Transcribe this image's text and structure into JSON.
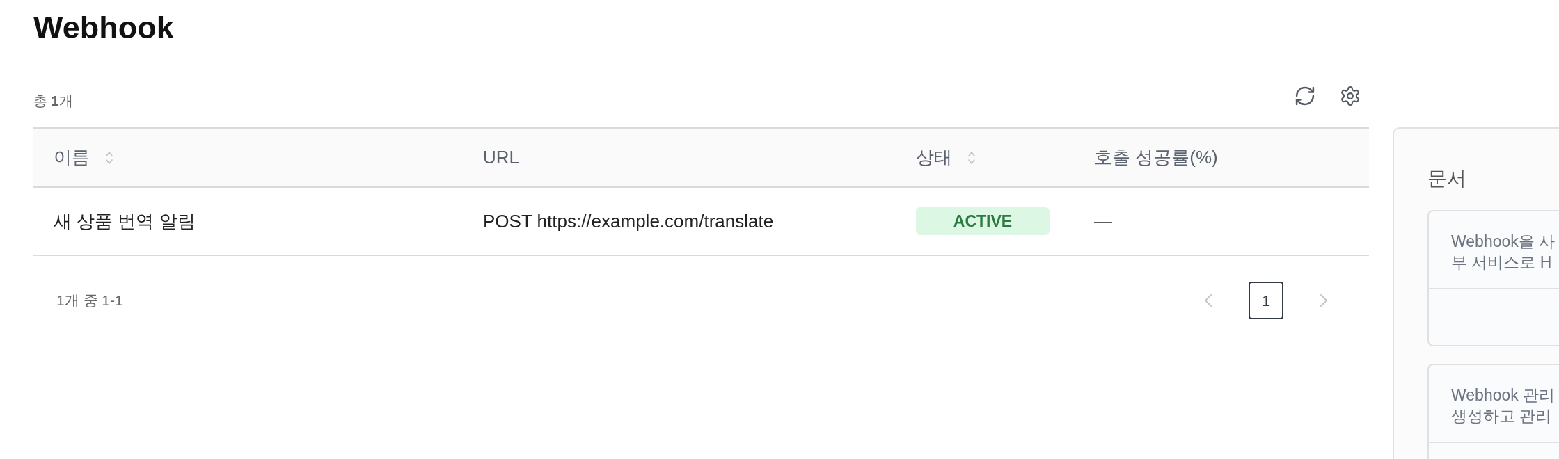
{
  "page": {
    "title": "Webhook"
  },
  "toolbar": {
    "count": "총 **1**개"
  },
  "table": {
    "columns": [
      {
        "label": "이름",
        "sortable": true
      },
      {
        "label": "URL",
        "sortable": false
      },
      {
        "label": "상태",
        "sortable": true
      },
      {
        "label": "호출 성공률(%)",
        "sortable": false
      }
    ],
    "rows": [
      {
        "name": "새 상품 번역 알림",
        "url": "POST https://example.com/translate",
        "status": {
          "label": "ACTIVE",
          "kind": "active"
        },
        "success_rate": "—"
      }
    ]
  },
  "pagination": {
    "summary": "1개 중 1-1",
    "previous": {
      "disabled": true
    },
    "pages": [
      {
        "label": "1",
        "selected": true
      }
    ],
    "next": {
      "disabled": true
    }
  },
  "docs_panel": {
    "title": "문서",
    "cards": [
      {
        "lines": [
          "Webhook을 사",
          "부 서비스로 H"
        ]
      },
      {
        "lines": [
          "Webhook 관리",
          "생성하고 관리"
        ]
      }
    ]
  }
}
